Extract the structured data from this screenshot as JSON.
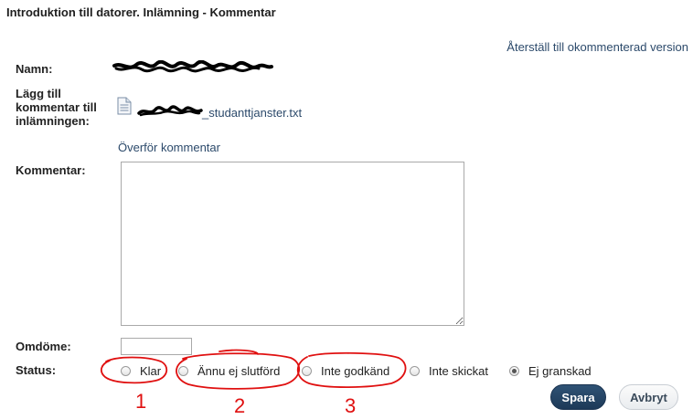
{
  "header": {
    "title": "Introduktion till datorer. Inlämning - Kommentar",
    "reset_link": "Återställ till okommenterad version"
  },
  "form": {
    "name_label": "Namn:",
    "add_comment_label_line1": "Lägg till",
    "add_comment_label_line2": "kommentar till",
    "add_comment_label_line3": "inlämningen:",
    "file_name": "_studanttjanster.txt",
    "transfer_link": "Överför kommentar",
    "comment_label": "Kommentar:",
    "comment_value": "",
    "grade_label": "Omdöme:",
    "grade_value": "",
    "status_label": "Status:",
    "status_options": [
      {
        "label": "Klar",
        "checked": false
      },
      {
        "label": "Ännu ej slutförd",
        "checked": false
      },
      {
        "label": "Inte godkänd",
        "checked": false
      },
      {
        "label": "Inte skickat",
        "checked": false
      },
      {
        "label": "Ej granskad",
        "checked": true
      }
    ]
  },
  "annotations": {
    "numbers": [
      "1",
      "2",
      "3"
    ],
    "color": "#e01010"
  },
  "buttons": {
    "save_label": "Spara",
    "cancel_label": "Avbryt"
  },
  "colors": {
    "link": "#2c4a6b",
    "save_button": "#24466a"
  }
}
